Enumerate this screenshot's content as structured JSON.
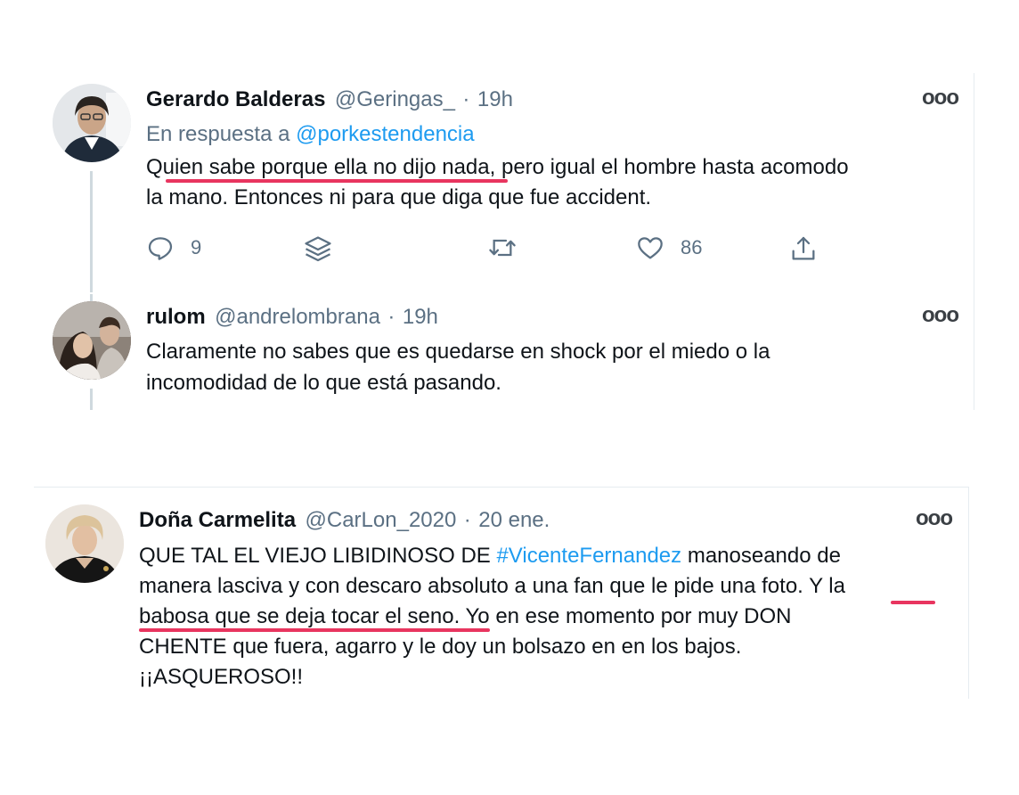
{
  "tweets": [
    {
      "name": "Gerardo Balderas",
      "handle": "@Geringas_",
      "sep": "·",
      "time": "19h",
      "reply_prefix": "En respuesta a",
      "reply_to": "@porkestendencia",
      "lines": [
        "Quien sabe porque ella no dijo nada, pero igual el hombre hasta acomodo",
        "la mano. Entonces ni para que diga que fue accident."
      ],
      "actions": {
        "replies": "9",
        "likes": "86"
      }
    },
    {
      "name": "rulom",
      "handle": "@andrelombrana",
      "sep": "·",
      "time": "19h",
      "lines": [
        "Claramente no sabes que es quedarse en shock por el miedo o la",
        "incomodidad de lo que está pasando."
      ]
    },
    {
      "name": "Doña Carmelita",
      "handle": "@CarLon_2020",
      "sep": "·",
      "time": "20 ene.",
      "line1_a": "QUE TAL EL VIEJO LIBIDINOSO DE ",
      "line1_tag": "#VicenteFernandez",
      "line1_b": " manoseando de",
      "lines": [
        "manera lasciva y con descaro absoluto a una fan que le pide una foto. Y la",
        "babosa que se deja tocar el seno. Yo en ese momento por muy DON",
        "CHENTE  que fuera, agarro y le doy un bolsazo en en los bajos.",
        "¡¡ASQUEROSO!!"
      ]
    }
  ],
  "more_label": "ooo",
  "colors": {
    "highlight": "#e8355f",
    "link": "#1d9bf0",
    "muted": "#5b7083"
  },
  "icons": [
    "reply-icon",
    "stack-icon",
    "retweet-icon",
    "like-icon",
    "share-icon",
    "more-icon"
  ]
}
